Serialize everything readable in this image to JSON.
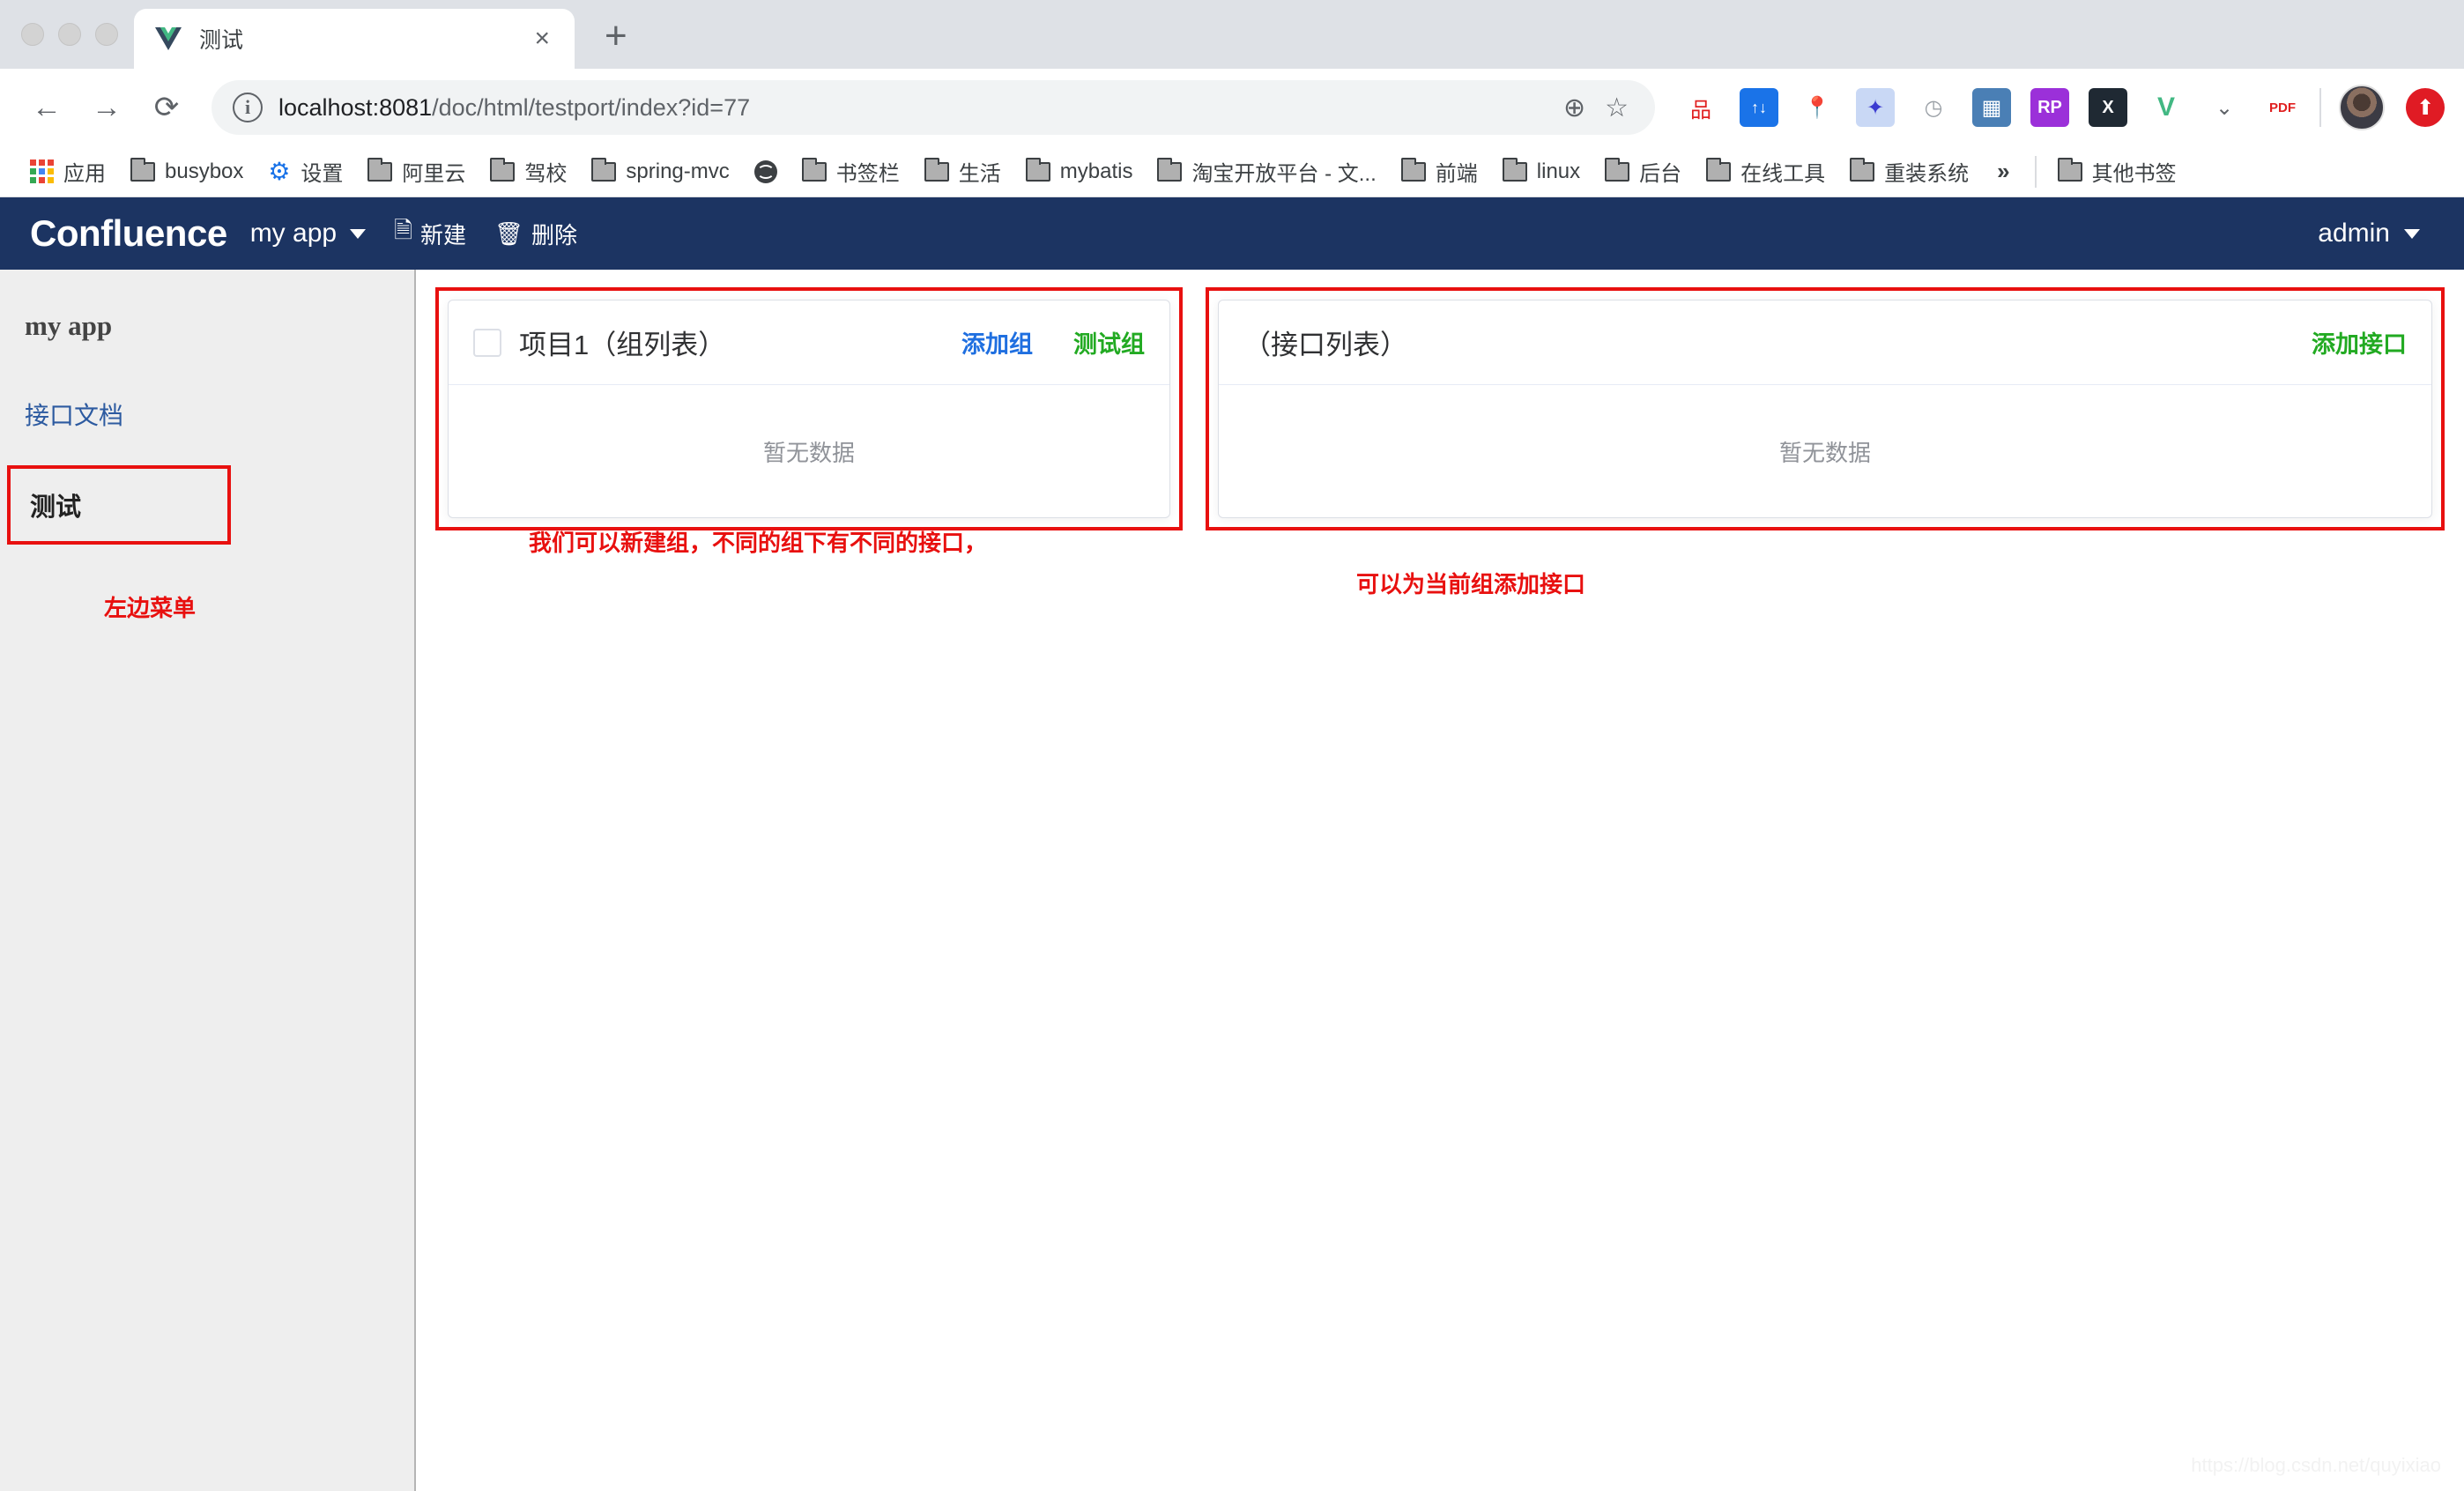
{
  "browser": {
    "tab": {
      "title": "测试",
      "favicon": "vue-logo-icon",
      "close_label": "×"
    },
    "new_tab_label": "+",
    "nav": {
      "back": "←",
      "forward": "→",
      "reload": "⟳"
    },
    "omnibox": {
      "info_glyph": "i",
      "url_host": "localhost:8081",
      "url_path": "/doc/html/testport/index?id=77",
      "zoom_icon": "⊕",
      "bookmark_icon": "☆"
    },
    "extensions": [
      {
        "name": "sitemap-extension-icon",
        "glyph": "品",
        "bg": "#ffffff",
        "fg": "#e02020"
      },
      {
        "name": "ex-uploader-extension-icon",
        "glyph": "↑↓",
        "bg": "#1a73e8",
        "fg": "#ffffff"
      },
      {
        "name": "location-pin-extension-icon",
        "glyph": "📍",
        "bg": "transparent",
        "fg": "#e02020"
      },
      {
        "name": "blue-bird-extension-icon",
        "glyph": "✦",
        "bg": "#c9d8f5",
        "fg": "#3b3bd0"
      },
      {
        "name": "speed-gauge-extension-icon",
        "glyph": "◷",
        "bg": "transparent",
        "fg": "#9aa0a6"
      },
      {
        "name": "image-viewer-extension-icon",
        "glyph": "▦",
        "bg": "#4a7fb5",
        "fg": "#ffffff"
      },
      {
        "name": "axure-rp-extension-icon",
        "glyph": "RP",
        "bg": "#9b30d9",
        "fg": "#ffffff"
      },
      {
        "name": "x-extension-icon",
        "glyph": "X",
        "bg": "#1f2933",
        "fg": "#ffffff"
      },
      {
        "name": "vue-devtools-extension-icon",
        "glyph": "V",
        "bg": "transparent",
        "fg": "#42b883"
      },
      {
        "name": "pocket-extension-icon",
        "glyph": "⌄",
        "bg": "transparent",
        "fg": "#5f6368"
      },
      {
        "name": "pdf-js-extension-icon",
        "glyph": "PDF",
        "bg": "#ffffff",
        "fg": "#e02020"
      }
    ],
    "avatar_name": "user-avatar",
    "upload_extension": {
      "name": "upload-arrow-extension-icon",
      "glyph": "⬆",
      "bg": "#e01b24",
      "fg": "#ffffff"
    },
    "bookmarks": [
      {
        "label": "应用",
        "icon": "apps-grid-icon"
      },
      {
        "label": "busybox",
        "icon": "folder-icon"
      },
      {
        "label": "设置",
        "icon": "gear-icon"
      },
      {
        "label": "阿里云",
        "icon": "folder-icon"
      },
      {
        "label": "驾校",
        "icon": "folder-icon"
      },
      {
        "label": "spring-mvc",
        "icon": "folder-icon"
      },
      {
        "label": "",
        "icon": "globe-icon"
      },
      {
        "label": "书签栏",
        "icon": "folder-icon"
      },
      {
        "label": "生活",
        "icon": "folder-icon"
      },
      {
        "label": "mybatis",
        "icon": "folder-icon"
      },
      {
        "label": "淘宝开放平台 - 文...",
        "icon": "folder-icon"
      },
      {
        "label": "前端",
        "icon": "folder-icon"
      },
      {
        "label": "linux",
        "icon": "folder-icon"
      },
      {
        "label": "后台",
        "icon": "folder-icon"
      },
      {
        "label": "在线工具",
        "icon": "folder-icon"
      },
      {
        "label": "重装系统",
        "icon": "folder-icon"
      }
    ],
    "bookmarks_overflow": "»",
    "other_bookmarks": {
      "label": "其他书签",
      "icon": "folder-icon"
    }
  },
  "navbar": {
    "brand": "Confluence",
    "app_menu": "my app",
    "new_icon": "document-icon",
    "new_label": "新建",
    "delete_icon": "trash-icon",
    "delete_label": "删除",
    "user": "admin",
    "bg_color": "#1c3462"
  },
  "sidebar": {
    "title": "my app",
    "link": "接口文档",
    "active_item": "测试",
    "note": "左边菜单",
    "note_color": "#e8100f"
  },
  "group_panel": {
    "checkbox_name": "select-all-groups-checkbox",
    "title": "项目1（组列表）",
    "add_group_label": "添加组",
    "add_group_color": "#1f6fe0",
    "test_group_label": "测试组",
    "test_group_color": "#22aa22",
    "empty": "暂无数据"
  },
  "api_panel": {
    "title": "（接口列表）",
    "add_api_label": "添加接口",
    "add_api_color": "#22aa22",
    "empty": "暂无数据"
  },
  "annotations": {
    "group": "我们可以新建组，不同的组下有不同的接口，",
    "api": "可以为当前组添加接口",
    "color": "#e8100f"
  },
  "watermark": "https://blog.csdn.net/quyixiao"
}
